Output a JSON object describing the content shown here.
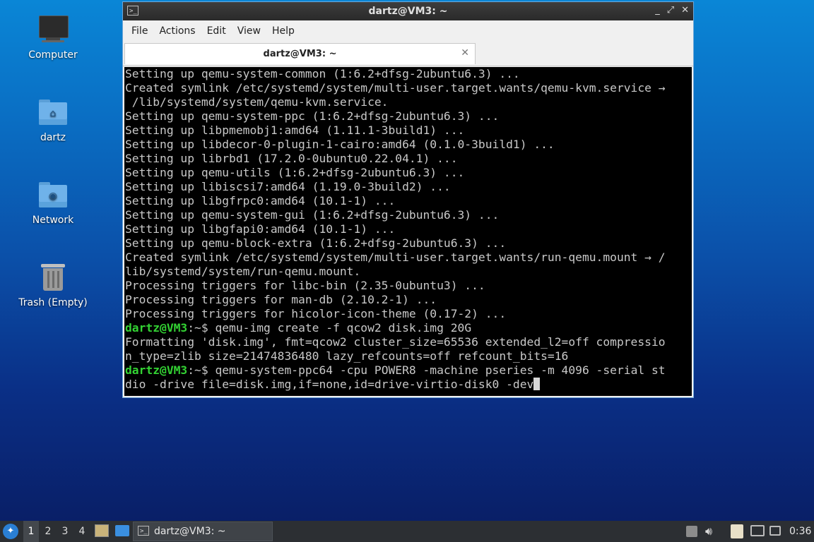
{
  "desktop": {
    "icons": [
      {
        "label": "Computer",
        "icon": "computer-icon"
      },
      {
        "label": "dartz",
        "icon": "home-folder-icon"
      },
      {
        "label": "Network",
        "icon": "network-folder-icon"
      },
      {
        "label": "Trash (Empty)",
        "icon": "trash-icon"
      }
    ]
  },
  "window": {
    "title": "dartz@VM3: ~",
    "buttons": {
      "minimize": "_",
      "maximize": "⤢",
      "close": "✕"
    },
    "menu": [
      "File",
      "Actions",
      "Edit",
      "View",
      "Help"
    ],
    "tab": {
      "label": "dartz@VM3: ~",
      "close": "✕"
    }
  },
  "terminal": {
    "lines": [
      {
        "text": "Setting up qemu-system-common (1:6.2+dfsg-2ubuntu6.3) ..."
      },
      {
        "text": "Created symlink /etc/systemd/system/multi-user.target.wants/qemu-kvm.service →"
      },
      {
        "text": " /lib/systemd/system/qemu-kvm.service."
      },
      {
        "text": "Setting up qemu-system-ppc (1:6.2+dfsg-2ubuntu6.3) ..."
      },
      {
        "text": "Setting up libpmemobj1:amd64 (1.11.1-3build1) ..."
      },
      {
        "text": "Setting up libdecor-0-plugin-1-cairo:amd64 (0.1.0-3build1) ..."
      },
      {
        "text": "Setting up librbd1 (17.2.0-0ubuntu0.22.04.1) ..."
      },
      {
        "text": "Setting up qemu-utils (1:6.2+dfsg-2ubuntu6.3) ..."
      },
      {
        "text": "Setting up libiscsi7:amd64 (1.19.0-3build2) ..."
      },
      {
        "text": "Setting up libgfrpc0:amd64 (10.1-1) ..."
      },
      {
        "text": "Setting up qemu-system-gui (1:6.2+dfsg-2ubuntu6.3) ..."
      },
      {
        "text": "Setting up libgfapi0:amd64 (10.1-1) ..."
      },
      {
        "text": "Setting up qemu-block-extra (1:6.2+dfsg-2ubuntu6.3) ..."
      },
      {
        "text": "Created symlink /etc/systemd/system/multi-user.target.wants/run-qemu.mount → /"
      },
      {
        "text": "lib/systemd/system/run-qemu.mount."
      },
      {
        "text": "Processing triggers for libc-bin (2.35-0ubuntu3) ..."
      },
      {
        "text": "Processing triggers for man-db (2.10.2-1) ..."
      },
      {
        "text": "Processing triggers for hicolor-icon-theme (0.17-2) ..."
      },
      {
        "prompt": "dartz@VM3",
        "text": ":~$ qemu-img create -f qcow2 disk.img 20G"
      },
      {
        "text": "Formatting 'disk.img', fmt=qcow2 cluster_size=65536 extended_l2=off compressio"
      },
      {
        "text": "n_type=zlib size=21474836480 lazy_refcounts=off refcount_bits=16"
      },
      {
        "prompt": "dartz@VM3",
        "text": ":~$ qemu-system-ppc64 -cpu POWER8 -machine pseries -m 4096 -serial st"
      },
      {
        "text": "dio -drive file=disk.img,if=none,id=drive-virtio-disk0 -dev",
        "cursor": true
      }
    ]
  },
  "taskbar": {
    "workspaces": [
      "1",
      "2",
      "3",
      "4"
    ],
    "active_workspace": "1",
    "task_title": "dartz@VM3: ~",
    "clock": "0:36"
  },
  "colors": {
    "prompt": "#33d233",
    "terminal_bg": "#000000",
    "terminal_fg": "#c8c8c8",
    "taskbar_bg": "#2c2f33"
  }
}
